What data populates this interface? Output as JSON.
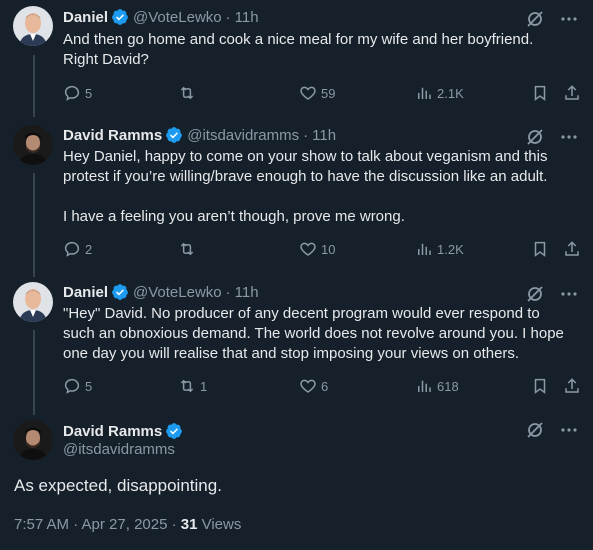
{
  "tweets": [
    {
      "name": "Daniel",
      "handle": "@VoteLewko",
      "time": "11h",
      "text": "And then go home and cook a nice meal for my wife and her boyfriend.\nRight David?",
      "replies": "5",
      "retweets": "",
      "likes": "59",
      "views": "2.1K"
    },
    {
      "name": "David Ramms",
      "handle": "@itsdavidramms",
      "time": "11h",
      "text": "Hey Daniel, happy to come on your show to talk about veganism and this\nprotest if you’re willing/brave enough to have the discussion like an adult.\n\nI have a feeling you aren’t though, prove me wrong.",
      "replies": "2",
      "retweets": "",
      "likes": "10",
      "views": "1.2K"
    },
    {
      "name": "Daniel",
      "handle": "@VoteLewko",
      "time": "11h",
      "text": "\"Hey\" David. No producer of any decent program would ever respond to\nsuch an obnoxious demand. The world does not revolve around you. I hope\none day you will realise that and stop imposing your views on others.",
      "replies": "5",
      "retweets": "1",
      "likes": "6",
      "views": "618"
    }
  ],
  "main": {
    "name": "David Ramms",
    "handle": "@itsdavidramms",
    "text": "As expected, disappointing.",
    "timestamp": "7:57 AM · Apr 27, 2025 · ",
    "views_count": "31",
    "views_label": " Views"
  },
  "separator": "·",
  "colors": {
    "background": "#15202b",
    "text": "#e7e9ea",
    "muted": "#8b98a5",
    "verified": "#1d9bf0",
    "thread_line": "#38444d"
  },
  "icons": [
    "verified-badge-icon",
    "grok-icon",
    "more-icon",
    "reply-icon",
    "retweet-icon",
    "like-icon",
    "views-icon",
    "bookmark-icon",
    "share-icon"
  ]
}
